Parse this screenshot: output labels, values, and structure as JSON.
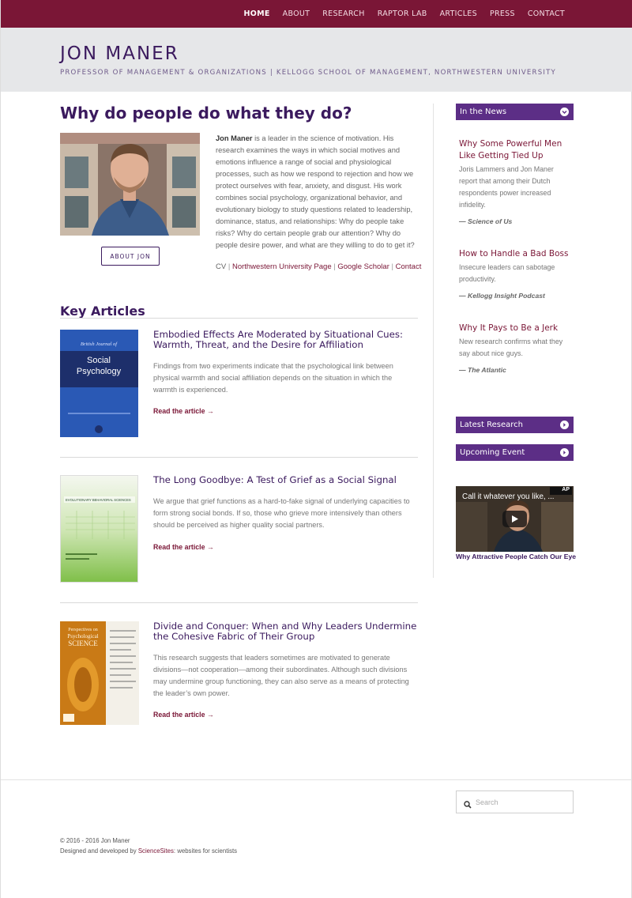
{
  "nav": {
    "items": [
      "HOME",
      "ABOUT",
      "RESEARCH",
      "RAPTOR LAB",
      "ARTICLES",
      "PRESS",
      "CONTACT"
    ],
    "active": "HOME"
  },
  "header": {
    "title": "JON MANER",
    "subtitle": "PROFESSOR OF MANAGEMENT & ORGANIZATIONS | KELLOGG SCHOOL OF MANAGEMENT, NORTHWESTERN UNIVERSITY"
  },
  "intro": {
    "headline": "Why do people do what they do?",
    "bio_name": "Jon Maner",
    "bio_text": " is a leader in the science of motivation. His research examines the ways in which social motives and emotions influence a range of social and physiological processes, such as how we respond to rejection and how we protect ourselves with fear, anxiety, and disgust. His work combines social psychology, organizational behavior, and evolutionary biology to study questions related to leadership, dominance, status, and relationships: Why do people take risks? Why do certain people grab our attention? Why do people desire power, and what are they willing to do to get it?",
    "about_button": "ABOUT JON",
    "links": {
      "cv": "CV",
      "northwestern": "Northwestern University Page",
      "scholar": "Google Scholar",
      "contact": "Contact",
      "separator": "|"
    }
  },
  "key_articles": {
    "heading": "Key Articles",
    "read_label": "Read the article →",
    "items": [
      {
        "title": "Embodied Effects Are Moderated by Situational Cues: Warmth, Threat, and the Desire for Affiliation",
        "summary": "Findings from two experiments indicate that the psychological link between physical warmth and social affiliation depends on the situation in which the warmth is experienced.",
        "cover": {
          "journal_top": "British Journal of",
          "journal_main_1": "Social",
          "journal_main_2": "Psychology",
          "color": "#2a59b5"
        }
      },
      {
        "title": "The Long Goodbye: A Test of Grief as a Social Signal",
        "summary": "We argue that grief functions as a hard-to-fake signal of underlying capacities to form strong social bonds. If so, those who grieve more intensively than others should be perceived as higher quality social partners.",
        "cover": {
          "journal_main_1": "EVOLUTIONARY BEHAVIORAL SCIENCES",
          "color": "#8cc455"
        }
      },
      {
        "title": "Divide and Conquer: When and Why Leaders Undermine the Cohesive Fabric of Their Group",
        "summary": "This research suggests that leaders sometimes are motivated to generate divisions—not cooperation—among their subordinates. Although such divisions may undermine group functioning, they can also serve as a means of protecting the leader’s own power.",
        "cover": {
          "journal_top": "Perspectives on",
          "journal_main_1": "Psychological",
          "journal_main_2": "SCIENCE",
          "color": "#c97a16"
        }
      }
    ]
  },
  "sidebar": {
    "in_the_news": "In the News",
    "news": [
      {
        "title": "Why Some Powerful Men Like Getting Tied Up",
        "body": "Joris Lammers and Jon Maner report that among their Dutch respondents power increased infidelity.",
        "source": "— Science of Us"
      },
      {
        "title": "How to Handle a Bad Boss",
        "body": "Insecure leaders can sabotage productivity.",
        "source": "— Kellogg Insight Podcast"
      },
      {
        "title": "Why It Pays to Be a Jerk",
        "body": "New research confirms what they say about nice guys.",
        "source": "— The Atlantic"
      }
    ],
    "latest_research": "Latest Research",
    "upcoming_event": "Upcoming Event",
    "video": {
      "overlay_title": "Call it whatever you like, ...",
      "badge": "AP",
      "caption": "Why Attractive People Catch Our Eye"
    }
  },
  "footer": {
    "search_placeholder": "Search",
    "copyright": "© 2016 - 2016 Jon Maner",
    "designed_prefix": "Designed and developed by ",
    "designed_brand": "ScienceSites",
    "designed_suffix": ": websites for scientists"
  },
  "colors": {
    "nav_bg": "#7a1636",
    "accent_purple": "#5c2e86",
    "title_purple": "#3b1a5e",
    "header_bg": "#e6e7e9"
  }
}
